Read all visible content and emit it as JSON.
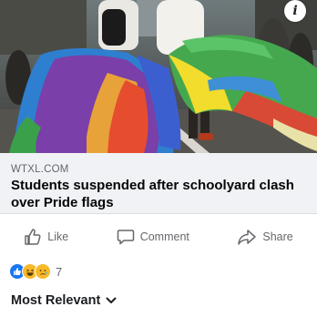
{
  "link_preview": {
    "domain": "WTXL.COM",
    "headline": "Students suspended after schoolyard clash over Pride flags"
  },
  "actions": {
    "like_label": "Like",
    "comment_label": "Comment",
    "share_label": "Share"
  },
  "reactions": {
    "icons": [
      "like-icon",
      "haha-icon",
      "sad-icon"
    ],
    "count": "7"
  },
  "comments_sort": {
    "label": "Most Relevant"
  },
  "colors": {
    "like_blue": "#1877f2",
    "reaction_yellow": "#f7b928",
    "link_card_bg": "#f0f2f5",
    "muted_text": "#65676b"
  }
}
